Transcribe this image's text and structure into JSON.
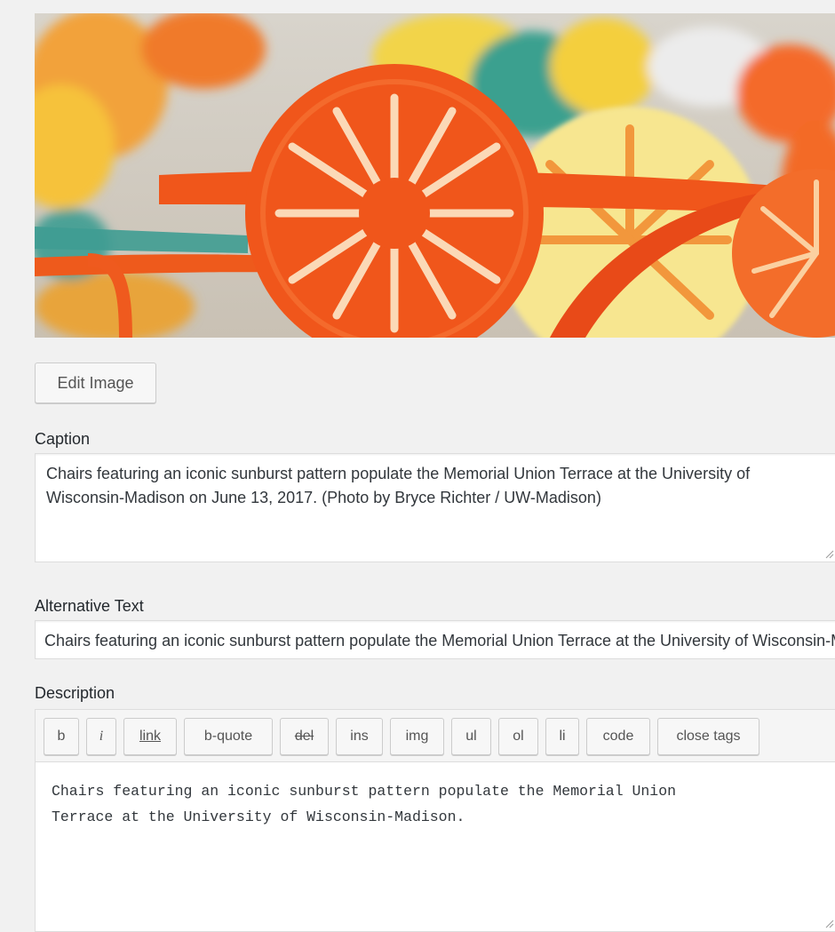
{
  "image": {
    "alt": "Chairs featuring an iconic sunburst pattern populate the Memorial Union Terrace at the University of Wisconsin-Madison."
  },
  "edit_image_button": "Edit Image",
  "caption": {
    "label": "Caption",
    "value": "Chairs featuring an iconic sunburst pattern populate the Memorial Union Terrace at the University of Wisconsin-Madison on June 13, 2017. (Photo by Bryce Richter / UW-Madison)"
  },
  "alt_text": {
    "label": "Alternative Text",
    "value": "Chairs featuring an iconic sunburst pattern populate the Memorial Union Terrace at the University of Wisconsin-Madison."
  },
  "description": {
    "label": "Description",
    "toolbar": [
      "b",
      "i",
      "link",
      "b-quote",
      "del",
      "ins",
      "img",
      "ul",
      "ol",
      "li",
      "code",
      "close tags"
    ],
    "value": "Chairs featuring an iconic sunburst pattern populate the Memorial Union\nTerrace at the University of Wisconsin-Madison."
  },
  "colors": {
    "chair_orange": "#f05a1e",
    "chair_yellow": "#f6e27a",
    "background": "#f1f1f1"
  }
}
